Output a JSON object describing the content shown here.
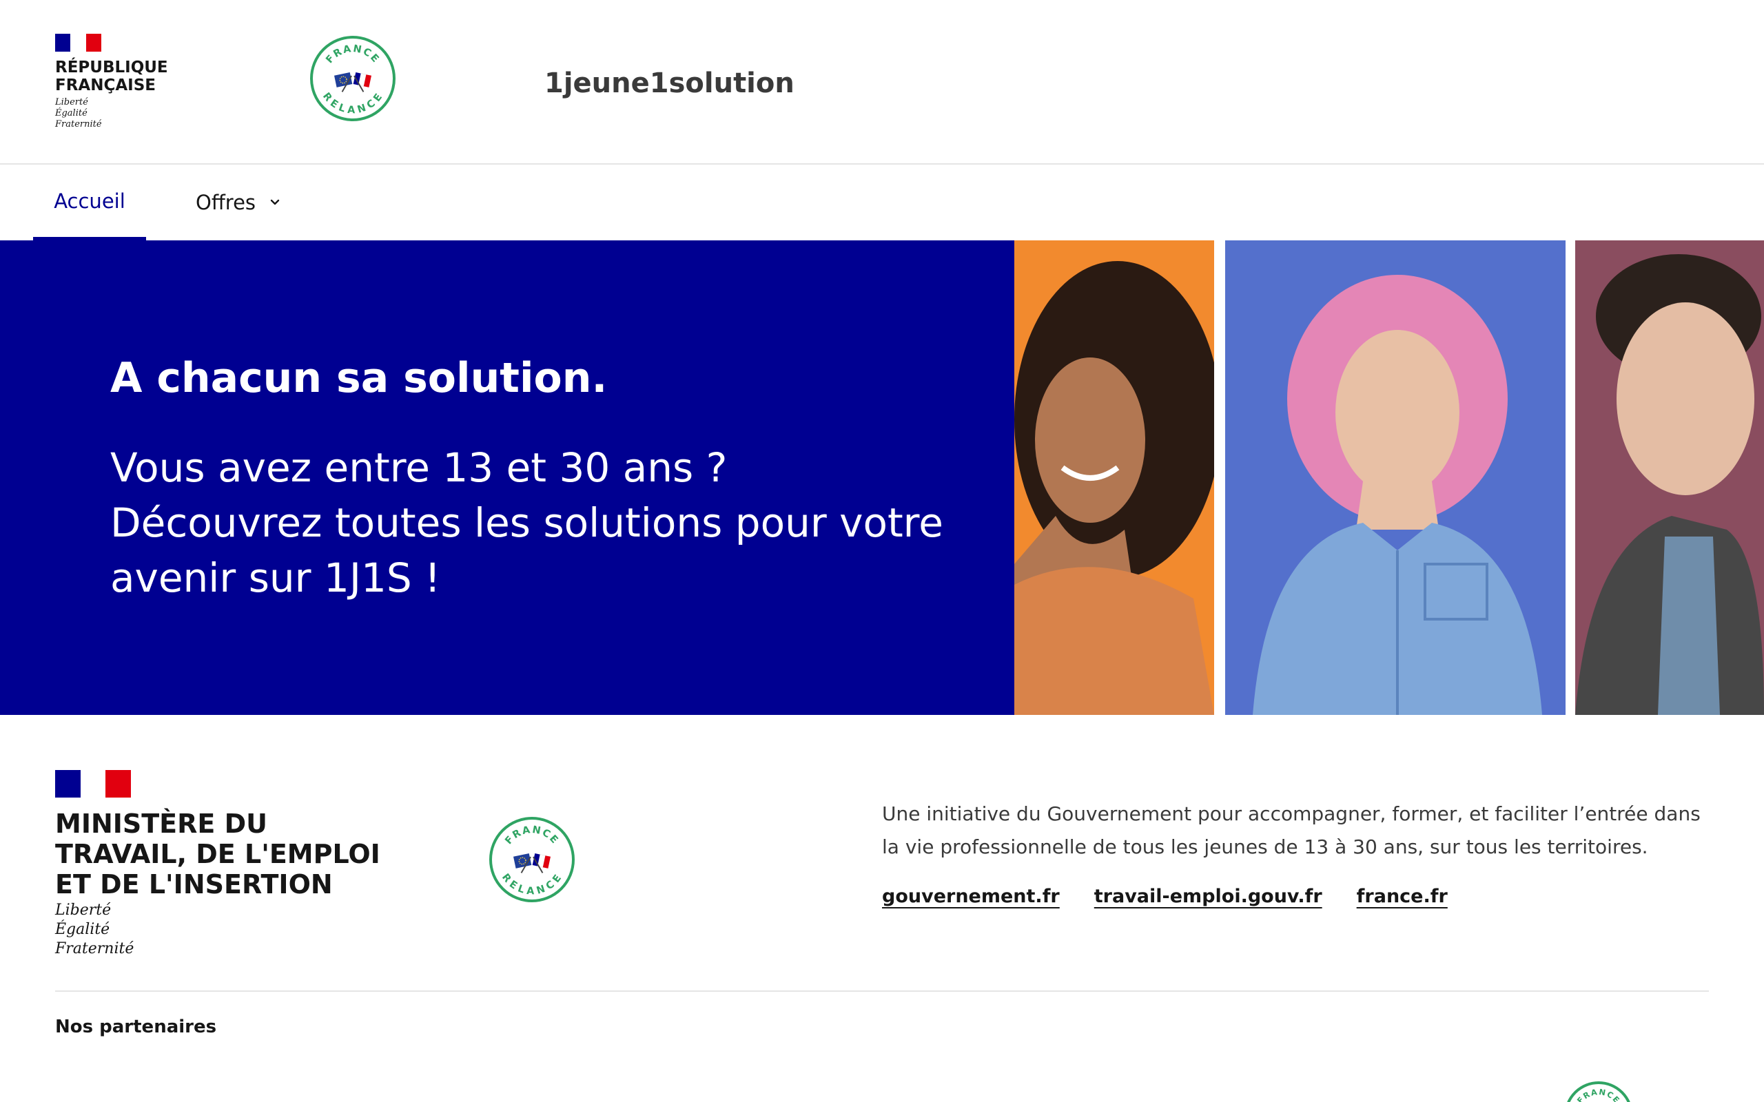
{
  "header": {
    "republique": "RÉPUBLIQUE",
    "francaise": "FRANÇAISE",
    "motto": [
      "Liberté",
      "Égalité",
      "Fraternité"
    ],
    "site_name": "1jeune1solution",
    "relance_top": "FRANCE",
    "relance_bottom": "RELANCE"
  },
  "nav": {
    "items": [
      {
        "label": "Accueil",
        "active": true
      },
      {
        "label": "Offres",
        "has_dropdown": true
      }
    ]
  },
  "hero": {
    "title": "A chacun sa solution.",
    "subtitle": "Vous avez entre 13 et 30 ans ? Découvrez toutes les solutions pour votre avenir sur 1J1S !"
  },
  "footer": {
    "ministry_lines": [
      "MINISTÈRE DU",
      "TRAVAIL, DE L'EMPLOI",
      "ET DE L'INSERTION"
    ],
    "motto": [
      "Liberté",
      "Égalité",
      "Fraternité"
    ],
    "initiative": "Une initiative du Gouvernement pour accompagner, former, et faciliter l’entrée dans la vie professionnelle de tous les jeunes de 13 à 30 ans, sur tous les territoires.",
    "links": [
      "gouvernement.fr",
      "travail-emploi.gouv.fr",
      "france.fr"
    ],
    "partners_title": "Nos partenaires"
  },
  "colors": {
    "primary_blue": "#000091",
    "republic_red": "#e1000f",
    "relance_green": "#2fa463",
    "photo_bg_orange": "#f28a2e",
    "photo_bg_blue": "#5470cc",
    "photo_bg_mauve": "#8a4d5f"
  },
  "icons": [
    "marianne-flag-logo",
    "france-relance-badge",
    "chevron-down-icon"
  ]
}
